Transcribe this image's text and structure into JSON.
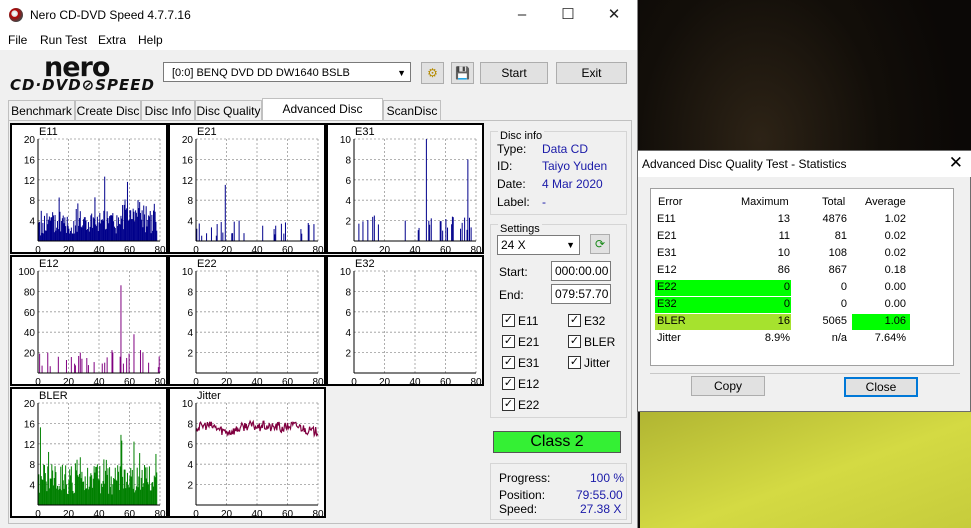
{
  "window": {
    "title": "Nero CD-DVD Speed 4.7.7.16",
    "menu": [
      "File",
      "Run Test",
      "Extra",
      "Help"
    ],
    "logo_top": "nero",
    "logo_bottom": "CD·DVD⊘SPEED",
    "drive": "[0:0]   BENQ DVD DD DW1640 BSLB",
    "start_label": "Start",
    "exit_label": "Exit",
    "tabs": [
      "Benchmark",
      "Create Disc",
      "Disc Info",
      "Disc Quality",
      "Advanced Disc Quality",
      "ScanDisc"
    ],
    "active_tab": "Advanced Disc Quality"
  },
  "disc_info": {
    "title": "Disc info",
    "type_label": "Type:",
    "type": "Data CD",
    "id_label": "ID:",
    "id": "Taiyo Yuden",
    "date_label": "Date:",
    "date": "4 Mar 2020",
    "label_label": "Label:",
    "label": "-"
  },
  "settings": {
    "title": "Settings",
    "speed": "24 X",
    "start_label": "Start:",
    "start": "000:00.00",
    "end_label": "End:",
    "end": "079:57.70",
    "checks": [
      {
        "label": "E11",
        "checked": true
      },
      {
        "label": "E32",
        "checked": true
      },
      {
        "label": "E21",
        "checked": true
      },
      {
        "label": "BLER",
        "checked": true
      },
      {
        "label": "E31",
        "checked": true
      },
      {
        "label": "Jitter",
        "checked": true
      },
      {
        "label": "E12",
        "checked": true
      },
      {
        "label": "E22",
        "checked": true
      }
    ]
  },
  "class_label": "Class 2",
  "progress": {
    "progress_label": "Progress:",
    "progress": "100 %",
    "position_label": "Position:",
    "position": "79:55.00",
    "speed_label": "Speed:",
    "speed": "27.38 X"
  },
  "chart_data": [
    {
      "name": "E11",
      "type": "bar",
      "color": "#00008b",
      "x_ticks": [
        0,
        20,
        40,
        60,
        80
      ],
      "y_ticks": [
        4,
        8,
        12,
        16,
        20
      ],
      "ylim": [
        0,
        20
      ],
      "xlim": [
        0,
        80
      ]
    },
    {
      "name": "E21",
      "type": "bar",
      "color": "#00008b",
      "x_ticks": [
        0,
        20,
        40,
        60,
        80
      ],
      "y_ticks": [
        4,
        8,
        12,
        16,
        20
      ],
      "ylim": [
        0,
        20
      ],
      "xlim": [
        0,
        80
      ]
    },
    {
      "name": "E31",
      "type": "bar",
      "color": "#00008b",
      "x_ticks": [
        0,
        20,
        40,
        60,
        80
      ],
      "y_ticks": [
        2,
        4,
        6,
        8,
        10
      ],
      "ylim": [
        0,
        10
      ],
      "xlim": [
        0,
        80
      ]
    },
    {
      "name": "E12",
      "type": "bar",
      "color": "#800080",
      "x_ticks": [
        0,
        20,
        40,
        60,
        80
      ],
      "y_ticks": [
        20,
        40,
        60,
        80,
        100
      ],
      "ylim": [
        0,
        100
      ],
      "xlim": [
        0,
        80
      ]
    },
    {
      "name": "E22",
      "type": "bar",
      "color": "#800080",
      "x_ticks": [
        0,
        20,
        40,
        60,
        80
      ],
      "y_ticks": [
        2,
        4,
        6,
        8,
        10
      ],
      "ylim": [
        0,
        10
      ],
      "xlim": [
        0,
        80
      ]
    },
    {
      "name": "E32",
      "type": "bar",
      "color": "#800080",
      "x_ticks": [
        0,
        20,
        40,
        60,
        80
      ],
      "y_ticks": [
        2,
        4,
        6,
        8,
        10
      ],
      "ylim": [
        0,
        10
      ],
      "xlim": [
        0,
        80
      ]
    },
    {
      "name": "BLER",
      "type": "bar",
      "color": "#008000",
      "x_ticks": [
        0,
        20,
        40,
        60,
        80
      ],
      "y_ticks": [
        4,
        8,
        12,
        16,
        20
      ],
      "ylim": [
        0,
        20
      ],
      "xlim": [
        0,
        80
      ]
    },
    {
      "name": "Jitter",
      "type": "line",
      "color": "#800040",
      "x_ticks": [
        0,
        20,
        40,
        60,
        80
      ],
      "y_ticks": [
        2,
        4,
        6,
        8,
        10
      ],
      "ylim": [
        0,
        10
      ],
      "xlim": [
        0,
        80
      ]
    }
  ],
  "stats": {
    "title": "Advanced Disc Quality Test - Statistics",
    "headers": [
      "Error",
      "Maximum",
      "Total",
      "Average"
    ],
    "rows": [
      {
        "error": "E11",
        "maximum": "13",
        "total": "4876",
        "average": "1.02",
        "hl": ""
      },
      {
        "error": "E21",
        "maximum": "11",
        "total": "81",
        "average": "0.02",
        "hl": ""
      },
      {
        "error": "E31",
        "maximum": "10",
        "total": "108",
        "average": "0.02",
        "hl": ""
      },
      {
        "error": "E12",
        "maximum": "86",
        "total": "867",
        "average": "0.18",
        "hl": ""
      },
      {
        "error": "E22",
        "maximum": "0",
        "total": "0",
        "average": "0.00",
        "hl": "green"
      },
      {
        "error": "E32",
        "maximum": "0",
        "total": "0",
        "average": "0.00",
        "hl": "green"
      },
      {
        "error": "BLER",
        "maximum": "16",
        "total": "5065",
        "average": "1.06",
        "hl": "lgreen"
      },
      {
        "error": "Jitter",
        "maximum": "8.9%",
        "total": "n/a",
        "average": "7.64%",
        "hl": ""
      }
    ],
    "copy_label": "Copy",
    "close_label": "Close"
  }
}
